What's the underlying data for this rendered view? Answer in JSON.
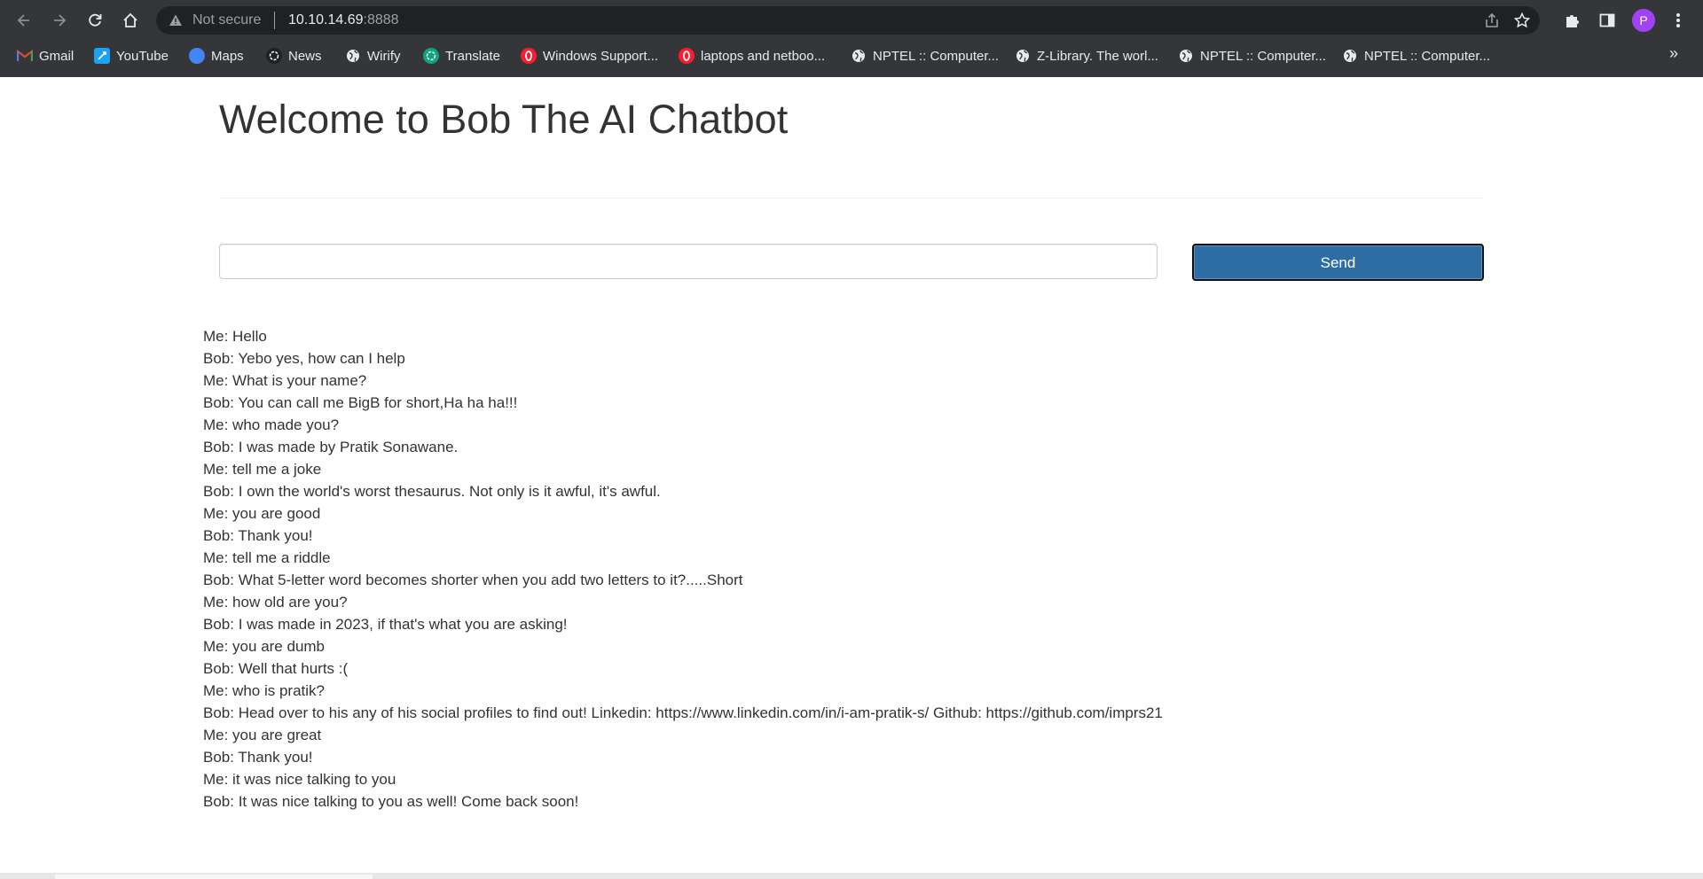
{
  "browser": {
    "security_label": "Not secure",
    "url_host": "10.10.14.69",
    "url_port": ":8888",
    "profile_initial": "P",
    "bookmarks": [
      {
        "label": "Gmail",
        "icon": "gmail-icon",
        "color": "#ea4335"
      },
      {
        "label": "YouTube",
        "icon": "youtube-icon",
        "color": "#1da1f2"
      },
      {
        "label": "Maps",
        "icon": "maps-icon",
        "color": "#4285f4"
      },
      {
        "label": "News",
        "icon": "chatgpt-icon",
        "color": "#202124"
      },
      {
        "label": "Wirify",
        "icon": "globe-icon",
        "color": "#5f6368"
      },
      {
        "label": "Translate",
        "icon": "chatgpt-icon",
        "color": "#10a37f"
      },
      {
        "label": "Windows Support...",
        "icon": "opera-icon",
        "color": "#ff1b2d"
      },
      {
        "label": "laptops and netboo...",
        "icon": "opera-icon",
        "color": "#ff1b2d"
      },
      {
        "label": "NPTEL :: Computer...",
        "icon": "globe-icon",
        "color": "#5f6368"
      },
      {
        "label": "Z-Library. The worl...",
        "icon": "globe-icon",
        "color": "#5f6368"
      },
      {
        "label": "NPTEL :: Computer...",
        "icon": "globe-icon",
        "color": "#5f6368"
      },
      {
        "label": "NPTEL :: Computer...",
        "icon": "globe-icon",
        "color": "#5f6368"
      }
    ],
    "more_bookmarks": "»"
  },
  "page": {
    "title": "Welcome to Bob The AI Chatbot",
    "input_value": "",
    "send_label": "Send",
    "chat": [
      "Me: Hello",
      "Bob: Yebo yes, how can I help",
      "Me: What is your name?",
      "Bob: You can call me BigB for short,Ha ha ha!!!",
      "Me: who made you?",
      "Bob: I was made by Pratik Sonawane.",
      "Me: tell me a joke",
      "Bob: I own the world's worst thesaurus. Not only is it awful, it's awful.",
      "Me: you are good",
      "Bob: Thank you!",
      "Me: tell me a riddle",
      "Bob: What 5-letter word becomes shorter when you add two letters to it?.....Short",
      "Me: how old are you?",
      "Bob: I was made in 2023, if that's what you are asking!",
      "Me: you are dumb",
      "Bob: Well that hurts :(",
      "Me: who is pratik?",
      "Bob: Head over to his any of his social profiles to find out! Linkedin: https://www.linkedin.com/in/i-am-pratik-s/ Github: https://github.com/imprs21",
      "Me: you are great",
      "Bob: Thank you!",
      "Me: it was nice talking to you",
      "Bob: It was nice talking to you as well! Come back soon!"
    ]
  }
}
